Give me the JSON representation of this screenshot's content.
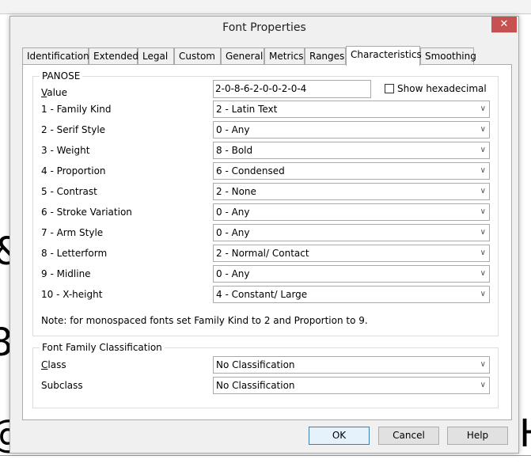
{
  "dialog": {
    "title": "Font Properties",
    "close_icon": "close-icon"
  },
  "tabs": [
    {
      "label": "Identification"
    },
    {
      "label": "Extended"
    },
    {
      "label": "Legal"
    },
    {
      "label": "Custom"
    },
    {
      "label": "General"
    },
    {
      "label": "Metrics"
    },
    {
      "label": "Ranges"
    },
    {
      "label": "Characteristics",
      "active": true
    },
    {
      "label": "Smoothing"
    }
  ],
  "panose": {
    "group_label": "PANOSE",
    "value_label": "Value",
    "value": "2-0-8-6-2-0-0-2-0-4",
    "show_hex_label": "Show hexadecimal",
    "show_hex_checked": false,
    "rows": [
      {
        "label": "1 - Family Kind",
        "value": "2 - Latin Text"
      },
      {
        "label": "2 - Serif Style",
        "value": "0 - Any"
      },
      {
        "label": "3 - Weight",
        "value": "8 - Bold"
      },
      {
        "label": "4 - Proportion",
        "value": "6 - Condensed"
      },
      {
        "label": "5 - Contrast",
        "value": "2 - None"
      },
      {
        "label": "6 - Stroke Variation",
        "value": "0 - Any"
      },
      {
        "label": "7 - Arm Style",
        "value": "0 - Any"
      },
      {
        "label": "8 - Letterform",
        "value": "2 - Normal/ Contact"
      },
      {
        "label": "9 - Midline",
        "value": "0 - Any"
      },
      {
        "label": "10 - X-height",
        "value": "4 - Constant/ Large"
      }
    ],
    "note": "Note: for monospaced fonts set Family Kind to 2 and Proportion to 9."
  },
  "classification": {
    "group_label": "Font Family Classification",
    "class_label": "Class",
    "class_value": "No Classification",
    "subclass_label": "Subclass",
    "subclass_value": "No Classification"
  },
  "buttons": {
    "ok": "OK",
    "cancel": "Cancel",
    "help": "Help"
  }
}
